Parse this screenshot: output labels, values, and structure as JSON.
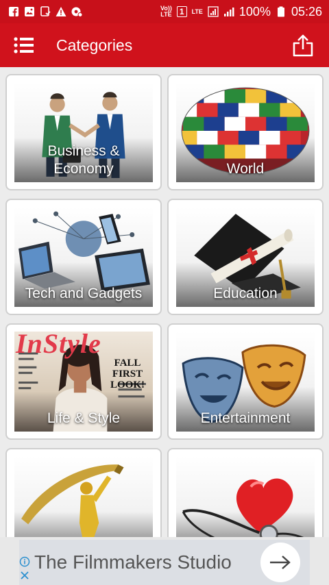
{
  "status_bar": {
    "network_label_top": "Vo))",
    "network_label_bottom": "LTE",
    "sim": "1",
    "lte_label": "LTE",
    "battery": "100%",
    "time": "05:26",
    "icons": [
      "facebook-icon",
      "image-icon",
      "message-icon",
      "warning-icon",
      "settings-icon",
      "sim-icon",
      "signal-icon",
      "battery-icon"
    ]
  },
  "app_bar": {
    "title": "Categories",
    "color": "#d0121c",
    "icons": [
      "menu-icon",
      "share-icon"
    ]
  },
  "categories": [
    {
      "label_line1": "Business &",
      "label_line2": "Economy"
    },
    {
      "label": "World"
    },
    {
      "label": "Tech and Gadgets"
    },
    {
      "label": "Education"
    },
    {
      "label": "Life & Style",
      "magazine_title": "InStyle",
      "cover_text": "FALL FIRST LOOK!"
    },
    {
      "label": "Entertainment"
    },
    {
      "label": ""
    },
    {
      "label": ""
    }
  ],
  "ad": {
    "text": "The Filmmakers Studio",
    "icons": [
      "adchoices-icon",
      "close-icon",
      "arrow-right-icon"
    ]
  }
}
